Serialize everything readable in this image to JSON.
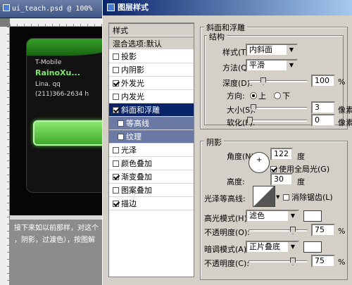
{
  "document": {
    "title": "ui_teach.psd @ 100%",
    "phone": {
      "carrier": "T-Mobile",
      "name": "RainoXu...",
      "qq": "Lina. qq",
      "number": "(211)366-2634 h"
    },
    "caption_lines": [
      "接下来如以前那样，对这个",
      "，阴影，过渡色），按图解"
    ]
  },
  "dialog": {
    "title": "图层样式",
    "style_list": {
      "header": "样式",
      "blend_header": "混合选项:默认",
      "items": [
        {
          "label": "投影",
          "checked": false,
          "level": "top"
        },
        {
          "label": "内阴影",
          "checked": false,
          "level": "top"
        },
        {
          "label": "外发光",
          "checked": true,
          "level": "top"
        },
        {
          "label": "内发光",
          "checked": false,
          "level": "top"
        },
        {
          "label": "斜面和浮雕",
          "checked": true,
          "level": "selected"
        },
        {
          "label": "等高线",
          "checked": false,
          "level": "sub"
        },
        {
          "label": "纹理",
          "checked": false,
          "level": "sub"
        },
        {
          "label": "光泽",
          "checked": false,
          "level": "top"
        },
        {
          "label": "颜色叠加",
          "checked": false,
          "level": "top"
        },
        {
          "label": "渐变叠加",
          "checked": true,
          "level": "top"
        },
        {
          "label": "图案叠加",
          "checked": false,
          "level": "top"
        },
        {
          "label": "描边",
          "checked": true,
          "level": "top"
        }
      ]
    },
    "bevel": {
      "section_title": "斜面和浮雕",
      "structure_title": "结构",
      "style_label": "样式(T):",
      "style_value": "内斜面",
      "method_label": "方法(Q):",
      "method_value": "平滑",
      "depth_label": "深度(D):",
      "depth_value": "100",
      "depth_unit": "%",
      "direction_label": "方向:",
      "direction_up": "上",
      "direction_down": "下",
      "size_label": "大小(S):",
      "size_value": "3",
      "size_unit": "像素",
      "soften_label": "软化(F):",
      "soften_value": "0",
      "soften_unit": "像素"
    },
    "shading": {
      "section_title": "阴影",
      "angle_label": "角度(N):",
      "angle_value": "122",
      "angle_unit": "度",
      "global_light_label": "使用全局光(G)",
      "global_light_checked": true,
      "altitude_label": "高度:",
      "altitude_value": "30",
      "altitude_unit": "度",
      "gloss_contour_label": "光泽等高线:",
      "anti_alias_label": "消除锯齿(L)",
      "anti_alias_checked": false,
      "highlight_mode_label": "高光模式(H):",
      "highlight_mode_value": "滤色",
      "highlight_opacity_label": "不透明度(O):",
      "highlight_opacity_value": "75",
      "shadow_mode_label": "暗调模式(A):",
      "shadow_mode_value": "正片叠底",
      "shadow_opacity_label": "不透明度(C):",
      "shadow_opacity_value": "75",
      "percent": "%"
    }
  }
}
